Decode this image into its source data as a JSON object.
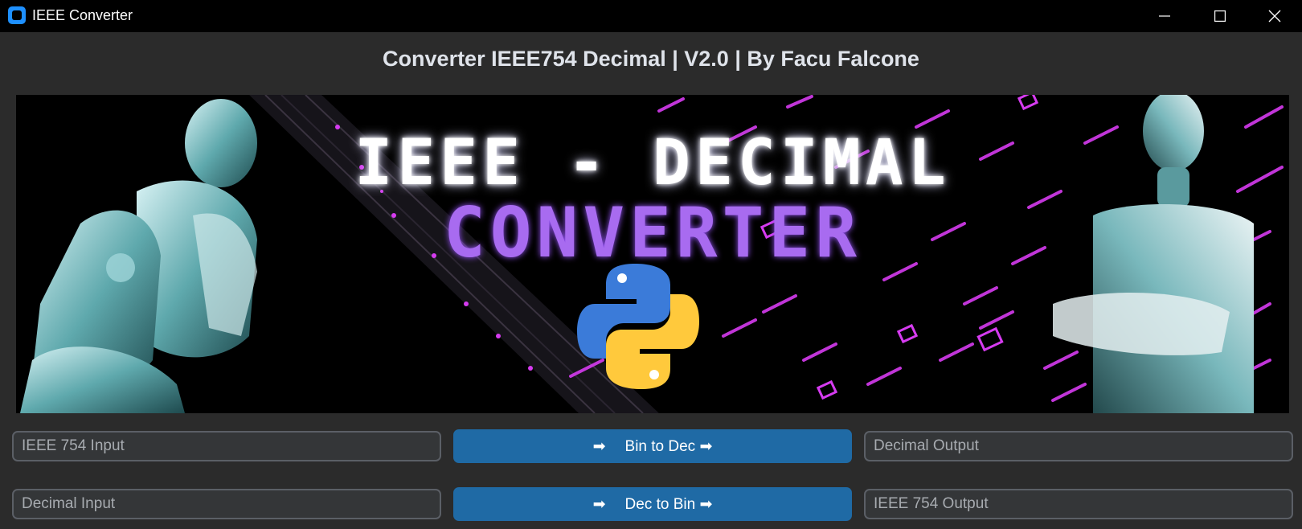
{
  "window": {
    "title": "IEEE Converter"
  },
  "header": {
    "title": "Converter IEEE754 Decimal | V2.0 | By Facu Falcone"
  },
  "banner": {
    "line1": "IEEE - DECIMAL",
    "line2": "CONVERTER",
    "logo_icon": "python-logo"
  },
  "row1": {
    "input_placeholder": "IEEE 754 Input",
    "button_label": "Bin to Dec",
    "button_arrow_left": "➡",
    "button_arrow_right": "➡",
    "output_placeholder": "Decimal Output"
  },
  "row2": {
    "input_placeholder": "Decimal Input",
    "button_label": "Dec to Bin",
    "button_arrow_left": "➡",
    "button_arrow_right": "➡",
    "output_placeholder": "IEEE 754 Output"
  },
  "colors": {
    "background": "#2b2b2b",
    "titlebar": "#000000",
    "button": "#1f6aa5",
    "field_border": "#5b5f66",
    "field_bg": "#343638",
    "neon_pink": "#d63bf0",
    "neon_purple": "#a86bf0"
  }
}
